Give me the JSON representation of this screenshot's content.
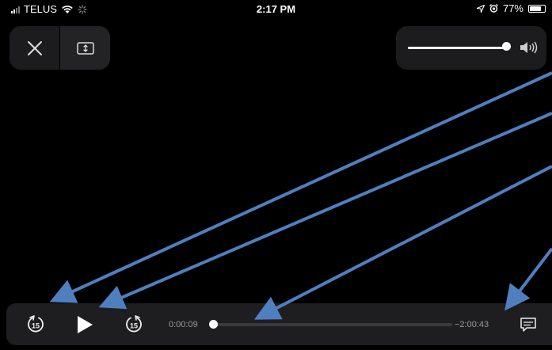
{
  "status_bar": {
    "carrier": "TELUS",
    "time": "2:17 PM",
    "battery": "77%",
    "battery_level": 0.77,
    "icons": [
      "signal-icon",
      "wifi-icon",
      "loading-spinner-icon",
      "location-arrow-icon",
      "alarm-icon",
      "battery-icon"
    ]
  },
  "top_controls": {
    "close_icon": "close-icon",
    "resize_icon": "resize-icon"
  },
  "volume": {
    "level": 0.96,
    "icon": "speaker-icon"
  },
  "player": {
    "skip_back_label": "15",
    "skip_forward_label": "15",
    "play_icon": "play-icon",
    "elapsed": "0:00:09",
    "remaining": "−2:00:43",
    "progress": 0.01,
    "captions_icon": "captions-icon"
  },
  "colors": {
    "background": "#000000",
    "pill": "#1c1c1e",
    "annotation_arrow": "#4f7fbf"
  }
}
